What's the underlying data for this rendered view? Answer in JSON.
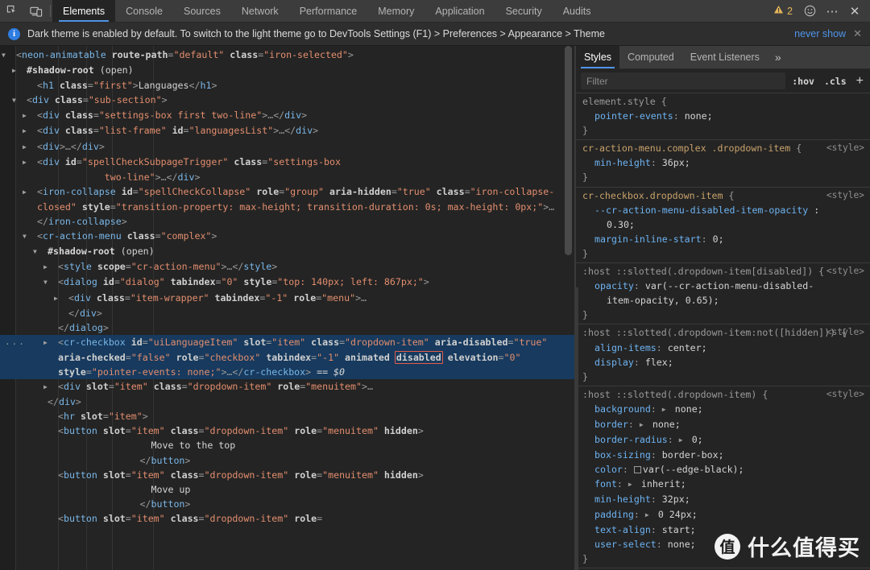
{
  "toolbar": {
    "icons": [
      {
        "name": "inspect-element-icon",
        "label": "Inspect"
      },
      {
        "name": "device-toolbar-icon",
        "label": "Toggle device toolbar"
      }
    ],
    "tabs": [
      {
        "label": "Elements",
        "active": true
      },
      {
        "label": "Console",
        "active": false
      },
      {
        "label": "Sources",
        "active": false
      },
      {
        "label": "Network",
        "active": false
      },
      {
        "label": "Performance",
        "active": false
      },
      {
        "label": "Memory",
        "active": false
      },
      {
        "label": "Application",
        "active": false
      },
      {
        "label": "Security",
        "active": false
      },
      {
        "label": "Audits",
        "active": false
      }
    ],
    "warning_count": "2",
    "warning_icon": "warning-triangle-icon",
    "feedback_icon": "smiley-face-icon",
    "more_icon": "more-options-icon",
    "more_glyph": "⋯",
    "close_icon": "close-icon",
    "close_glyph": "✕"
  },
  "notice": {
    "info_glyph": "i",
    "text": "Dark theme is enabled by default. To switch to the light theme go to DevTools Settings (F1) > Preferences > Appearance > Theme",
    "never_show_label": "never show",
    "close_glyph": "✕"
  },
  "dom": {
    "lines": [
      {
        "id": "l1",
        "indent": 0,
        "triangle": "▼",
        "html": "<span class='punc'>&lt;</span><span class='tag'>neon-animatable</span> <span class='attr'>route-path</span><span class='punc'>=</span><span class='val'>\"default\"</span> <span class='attr'>class</span><span class='punc'>=</span><span class='val'>\"iron-selected\"</span><span class='punc'>&gt;</span>",
        "text": "<neon-animatable route-path=\"default\" class=\"iron-selected\">"
      },
      {
        "id": "l2",
        "indent": 1,
        "triangle": "▶",
        "html": "<span class='shad'>#shadow-root</span> <span class='txtn'>(open)</span>",
        "text": "#shadow-root (open)"
      },
      {
        "id": "l3",
        "indent": 2,
        "triangle": "",
        "html": "<span class='punc'>&lt;</span><span class='tag'>h1</span> <span class='attr'>class</span><span class='punc'>=</span><span class='val'>\"first\"</span><span class='punc'>&gt;</span><span class='txtn'>Languages</span><span class='punc'>&lt;/</span><span class='tag'>h1</span><span class='punc'>&gt;</span>",
        "text": "<h1 class=\"first\">Languages</h1>"
      },
      {
        "id": "l4",
        "indent": 1,
        "triangle": "▼",
        "html": "<span class='punc'>&lt;</span><span class='tag'>div</span> <span class='attr'>class</span><span class='punc'>=</span><span class='val'>\"sub-section\"</span><span class='punc'>&gt;</span>",
        "text": "<div class=\"sub-section\">"
      },
      {
        "id": "l5",
        "indent": 2,
        "triangle": "▶",
        "html": "<span class='punc'>&lt;</span><span class='tag'>div</span> <span class='attr'>class</span><span class='punc'>=</span><span class='val'>\"settings-box first two-line\"</span><span class='punc'>&gt;…&lt;/</span><span class='tag'>div</span><span class='punc'>&gt;</span>",
        "text": "<div class=\"settings-box first two-line\">…</div>"
      },
      {
        "id": "l6",
        "indent": 2,
        "triangle": "▶",
        "html": "<span class='punc'>&lt;</span><span class='tag'>div</span> <span class='attr'>class</span><span class='punc'>=</span><span class='val'>\"list-frame\"</span> <span class='attr'>id</span><span class='punc'>=</span><span class='val'>\"languagesList\"</span><span class='punc'>&gt;…&lt;/</span><span class='tag'>div</span><span class='punc'>&gt;</span>",
        "text": "<div class=\"list-frame\" id=\"languagesList\">…</div>"
      },
      {
        "id": "l7",
        "indent": 2,
        "triangle": "▶",
        "html": "<span class='punc'>&lt;</span><span class='tag'>div</span><span class='punc'>&gt;…&lt;/</span><span class='tag'>div</span><span class='punc'>&gt;</span>",
        "text": "<div>…</div>"
      },
      {
        "id": "l8",
        "indent": 2,
        "triangle": "▶",
        "html": "<span class='punc'>&lt;</span><span class='tag'>div</span> <span class='attr'>id</span><span class='punc'>=</span><span class='val'>\"spellCheckSubpageTrigger\"</span> <span class='attr'>class</span><span class='punc'>=</span><span class='val'>\"settings-box\n            two-line\"</span><span class='punc'>&gt;…&lt;/</span><span class='tag'>div</span><span class='punc'>&gt;</span>",
        "text": "<div id=\"spellCheckSubpageTrigger\" class=\"settings-box two-line\">…</div>"
      },
      {
        "id": "l9",
        "indent": 2,
        "triangle": "▶",
        "html": "<span class='punc'>&lt;</span><span class='tag'>iron-collapse</span> <span class='attr'>id</span><span class='punc'>=</span><span class='val'>\"spellCheckCollapse\"</span> <span class='attr'>role</span><span class='punc'>=</span><span class='val'>\"group\"</span> <span class='attr'>aria-hidden</span><span class='punc'>=</span><span class='val'>\"true\"</span> <span class='attr'>class</span><span class='punc'>=</span><span class='val'>\"iron-collapse-closed\"</span> <span class='attr'>style</span><span class='punc'>=</span><span class='val'>\"transition-property: max-height; transition-duration: 0s; max-height: 0px;\"</span><span class='punc'>&gt;…&lt;/</span><span class='tag'>iron-collapse</span><span class='punc'>&gt;</span>",
        "text": "<iron-collapse id=\"spellCheckCollapse\" role=\"group\" aria-hidden=\"true\" class=\"iron-collapse-closed\" style=\"transition-property: max-height; transition-duration: 0s; max-height: 0px;\">…</iron-collapse>"
      },
      {
        "id": "l10",
        "indent": 2,
        "triangle": "▼",
        "html": "<span class='punc'>&lt;</span><span class='tag'>cr-action-menu</span> <span class='attr'>class</span><span class='punc'>=</span><span class='val'>\"complex\"</span><span class='punc'>&gt;</span>",
        "text": "<cr-action-menu class=\"complex\">"
      },
      {
        "id": "l11",
        "indent": 3,
        "triangle": "▼",
        "html": "<span class='shad'>#shadow-root</span> <span class='txtn'>(open)</span>",
        "text": "#shadow-root (open)"
      },
      {
        "id": "l12",
        "indent": 4,
        "triangle": "▶",
        "html": "<span class='punc'>&lt;</span><span class='tag'>style</span> <span class='attr'>scope</span><span class='punc'>=</span><span class='val'>\"cr-action-menu\"</span><span class='punc'>&gt;…&lt;/</span><span class='tag'>style</span><span class='punc'>&gt;</span>",
        "text": "<style scope=\"cr-action-menu\">…</style>"
      },
      {
        "id": "l13",
        "indent": 4,
        "triangle": "▼",
        "html": "<span class='punc'>&lt;</span><span class='tag'>dialog</span> <span class='attr'>id</span><span class='punc'>=</span><span class='val'>\"dialog\"</span> <span class='attr'>tabindex</span><span class='punc'>=</span><span class='val'>\"0\"</span> <span class='attr'>style</span><span class='punc'>=</span><span class='val'>\"top: 140px; left: 867px;\"</span><span class='punc'>&gt;</span>",
        "text": "<dialog id=\"dialog\" tabindex=\"0\" style=\"top: 140px; left: 867px;\">"
      },
      {
        "id": "l14",
        "indent": 5,
        "triangle": "▶",
        "html": "<span class='punc'>&lt;</span><span class='tag'>div</span> <span class='attr'>class</span><span class='punc'>=</span><span class='val'>\"item-wrapper\"</span> <span class='attr'>tabindex</span><span class='punc'>=</span><span class='val'>\"-1\"</span> <span class='attr'>role</span><span class='punc'>=</span><span class='val'>\"menu\"</span><span class='punc'>&gt;…</span>",
        "text": "<div class=\"item-wrapper\" tabindex=\"-1\" role=\"menu\">…"
      },
      {
        "id": "l15",
        "indent": 5,
        "triangle": "",
        "html": "<span class='punc'>&lt;/</span><span class='tag'>div</span><span class='punc'>&gt;</span>",
        "text": "</div>"
      },
      {
        "id": "l16",
        "indent": 4,
        "triangle": "",
        "html": "<span class='punc'>&lt;/</span><span class='tag'>dialog</span><span class='punc'>&gt;</span>",
        "text": "</dialog>"
      }
    ],
    "selected_line": {
      "id": "l17",
      "triangle": "▶",
      "gutter_dots": "···",
      "text": "<cr-checkbox id=\"uiLanguageItem\" slot=\"item\" class=\"dropdown-item\" aria-disabled=\"true\" aria-checked=\"false\" role=\"checkbox\" tabindex=\"-1\" animated disabled elevation=\"0\" style=\"pointer-events: none;\">…</cr-checkbox> == $0",
      "boxed_attribute": "disabled",
      "console_ref": "== $0"
    },
    "lines_after": [
      {
        "id": "l18",
        "indent": 4,
        "triangle": "▶",
        "html": "<span class='punc'>&lt;</span><span class='tag'>div</span> <span class='attr'>slot</span><span class='punc'>=</span><span class='val'>\"item\"</span> <span class='attr'>class</span><span class='punc'>=</span><span class='val'>\"dropdown-item\"</span> <span class='attr'>role</span><span class='punc'>=</span><span class='val'>\"menuitem\"</span><span class='punc'>&gt;…</span>",
        "text": "<div slot=\"item\" class=\"dropdown-item\" role=\"menuitem\">…"
      },
      {
        "id": "l19",
        "indent": 3,
        "triangle": "",
        "html": "<span class='punc'>&lt;/</span><span class='tag'>div</span><span class='punc'>&gt;</span>",
        "text": "</div>"
      },
      {
        "id": "l20",
        "indent": 4,
        "triangle": "",
        "html": "<span class='punc'>&lt;</span><span class='tag'>hr</span> <span class='attr'>slot</span><span class='punc'>=</span><span class='val'>\"item\"</span><span class='punc'>&gt;</span>",
        "text": "<hr slot=\"item\">"
      },
      {
        "id": "l21",
        "indent": 4,
        "triangle": "",
        "html": "<span class='punc'>&lt;</span><span class='tag'>button</span> <span class='attr'>slot</span><span class='punc'>=</span><span class='val'>\"item\"</span> <span class='attr'>class</span><span class='punc'>=</span><span class='val'>\"dropdown-item\"</span> <span class='attr'>role</span><span class='punc'>=</span><span class='val'>\"menuitem\"</span> <span class='attr'>hidden</span><span class='punc'>&gt;</span>",
        "text": "<button slot=\"item\" class=\"dropdown-item\" role=\"menuitem\" hidden>"
      },
      {
        "id": "l22",
        "indent": 0,
        "triangle": "",
        "html": "<span class='txtn'>                        Move to the top</span>",
        "text": "Move to the top"
      },
      {
        "id": "l23",
        "indent": 0,
        "triangle": "",
        "html": "<span class='punc'>                      &lt;/</span><span class='tag'>button</span><span class='punc'>&gt;</span>",
        "text": "</button>"
      },
      {
        "id": "l24",
        "indent": 4,
        "triangle": "",
        "html": "<span class='punc'>&lt;</span><span class='tag'>button</span> <span class='attr'>slot</span><span class='punc'>=</span><span class='val'>\"item\"</span> <span class='attr'>class</span><span class='punc'>=</span><span class='val'>\"dropdown-item\"</span> <span class='attr'>role</span><span class='punc'>=</span><span class='val'>\"menuitem\"</span> <span class='attr'>hidden</span><span class='punc'>&gt;</span>",
        "text": "<button slot=\"item\" class=\"dropdown-item\" role=\"menuitem\" hidden>"
      },
      {
        "id": "l25",
        "indent": 0,
        "triangle": "",
        "html": "<span class='txtn'>                        Move up</span>",
        "text": "Move up"
      },
      {
        "id": "l26",
        "indent": 0,
        "triangle": "",
        "html": "<span class='punc'>                      &lt;/</span><span class='tag'>button</span><span class='punc'>&gt;</span>",
        "text": "</button>"
      },
      {
        "id": "l27",
        "indent": 4,
        "triangle": "",
        "html": "<span class='punc'>&lt;</span><span class='tag'>button</span> <span class='attr'>slot</span><span class='punc'>=</span><span class='val'>\"item\"</span> <span class='attr'>class</span><span class='punc'>=</span><span class='val'>\"dropdown-item\"</span> <span class='attr'>role</span><span class='punc'>=</span>",
        "text": "<button slot=\"item\" class=\"dropdown-item\" role="
      }
    ]
  },
  "styles": {
    "tabs": [
      {
        "label": "Styles",
        "active": true
      },
      {
        "label": "Computed",
        "active": false
      },
      {
        "label": "Event Listeners",
        "active": false
      }
    ],
    "more_glyph": "»",
    "filter_placeholder": "Filter",
    "hov_label": ":hov",
    "cls_label": ".cls",
    "new_rule_glyph": "+",
    "rules": [
      {
        "selector": "element.style",
        "origin": "",
        "declarations": [
          {
            "property": "pointer-events",
            "value": "none;",
            "indent": 1,
            "expander": false,
            "swatch": false
          }
        ]
      },
      {
        "selector": "cr-action-menu.complex .dropdown-item",
        "origin": "<style>",
        "declarations": [
          {
            "property": "min-height",
            "value": "36px;",
            "indent": 1,
            "expander": false,
            "swatch": false
          }
        ]
      },
      {
        "selector": "cr-checkbox.dropdown-item",
        "origin": "<style>",
        "declarations": [
          {
            "property": "--cr-action-menu-disabled-item-opacity",
            "value": ":",
            "indent": 1,
            "expander": false,
            "swatch": false,
            "raw": "--cr-action-menu-disabled-item-opacity:"
          },
          {
            "property": "",
            "value": "0.30;",
            "indent": 2,
            "expander": false,
            "swatch": false
          },
          {
            "property": "margin-inline-start",
            "value": "0;",
            "indent": 1,
            "expander": false,
            "swatch": false
          }
        ]
      },
      {
        "selector": ":host ::slotted(.dropdown-item[disabled])",
        "origin": "<style>",
        "declarations": [
          {
            "property": "opacity",
            "value": "var(--cr-action-menu-disabled-",
            "indent": 1,
            "expander": false,
            "swatch": false
          },
          {
            "property": "",
            "value": "item-opacity, 0.65);",
            "indent": 2,
            "expander": false,
            "swatch": false
          }
        ]
      },
      {
        "selector": ":host ::slotted(.dropdown-item:not([hidden]))",
        "origin": "<style>",
        "declarations": [
          {
            "property": "align-items",
            "value": "center;",
            "indent": 1,
            "expander": false,
            "swatch": false
          },
          {
            "property": "display",
            "value": "flex;",
            "indent": 1,
            "expander": false,
            "swatch": false
          }
        ]
      },
      {
        "selector": ":host ::slotted(.dropdown-item)",
        "origin": "<style>",
        "declarations": [
          {
            "property": "background",
            "value": "none;",
            "indent": 1,
            "expander": true,
            "swatch": false
          },
          {
            "property": "border",
            "value": "none;",
            "indent": 1,
            "expander": true,
            "swatch": false
          },
          {
            "property": "border-radius",
            "value": "0;",
            "indent": 1,
            "expander": true,
            "swatch": false
          },
          {
            "property": "box-sizing",
            "value": "border-box;",
            "indent": 1,
            "expander": false,
            "swatch": false
          },
          {
            "property": "color",
            "value": "var(--edge-black);",
            "indent": 1,
            "expander": false,
            "swatch": true
          },
          {
            "property": "font",
            "value": "inherit;",
            "indent": 1,
            "expander": true,
            "swatch": false
          },
          {
            "property": "min-height",
            "value": "32px;",
            "indent": 1,
            "expander": false,
            "swatch": false
          },
          {
            "property": "padding",
            "value": "0 24px;",
            "indent": 1,
            "expander": true,
            "swatch": false
          },
          {
            "property": "text-align",
            "value": "start;",
            "indent": 1,
            "expander": false,
            "swatch": false
          },
          {
            "property": "user-select",
            "value": "none;",
            "indent": 1,
            "expander": false,
            "swatch": false
          }
        ]
      }
    ]
  },
  "watermark": {
    "badge": "值",
    "text": "什么值得买"
  },
  "colors": {
    "accent": "#4f94e8",
    "selection": "#173a5e",
    "toolbar_bg": "#3c3c3c",
    "panel_bg": "#242424",
    "tag": "#7ab7e8",
    "value": "#e38e6e",
    "property": "#6db3f2",
    "selector": "#c8a26b",
    "warning": "#e4b55a",
    "error_box": "#e25c4b"
  }
}
